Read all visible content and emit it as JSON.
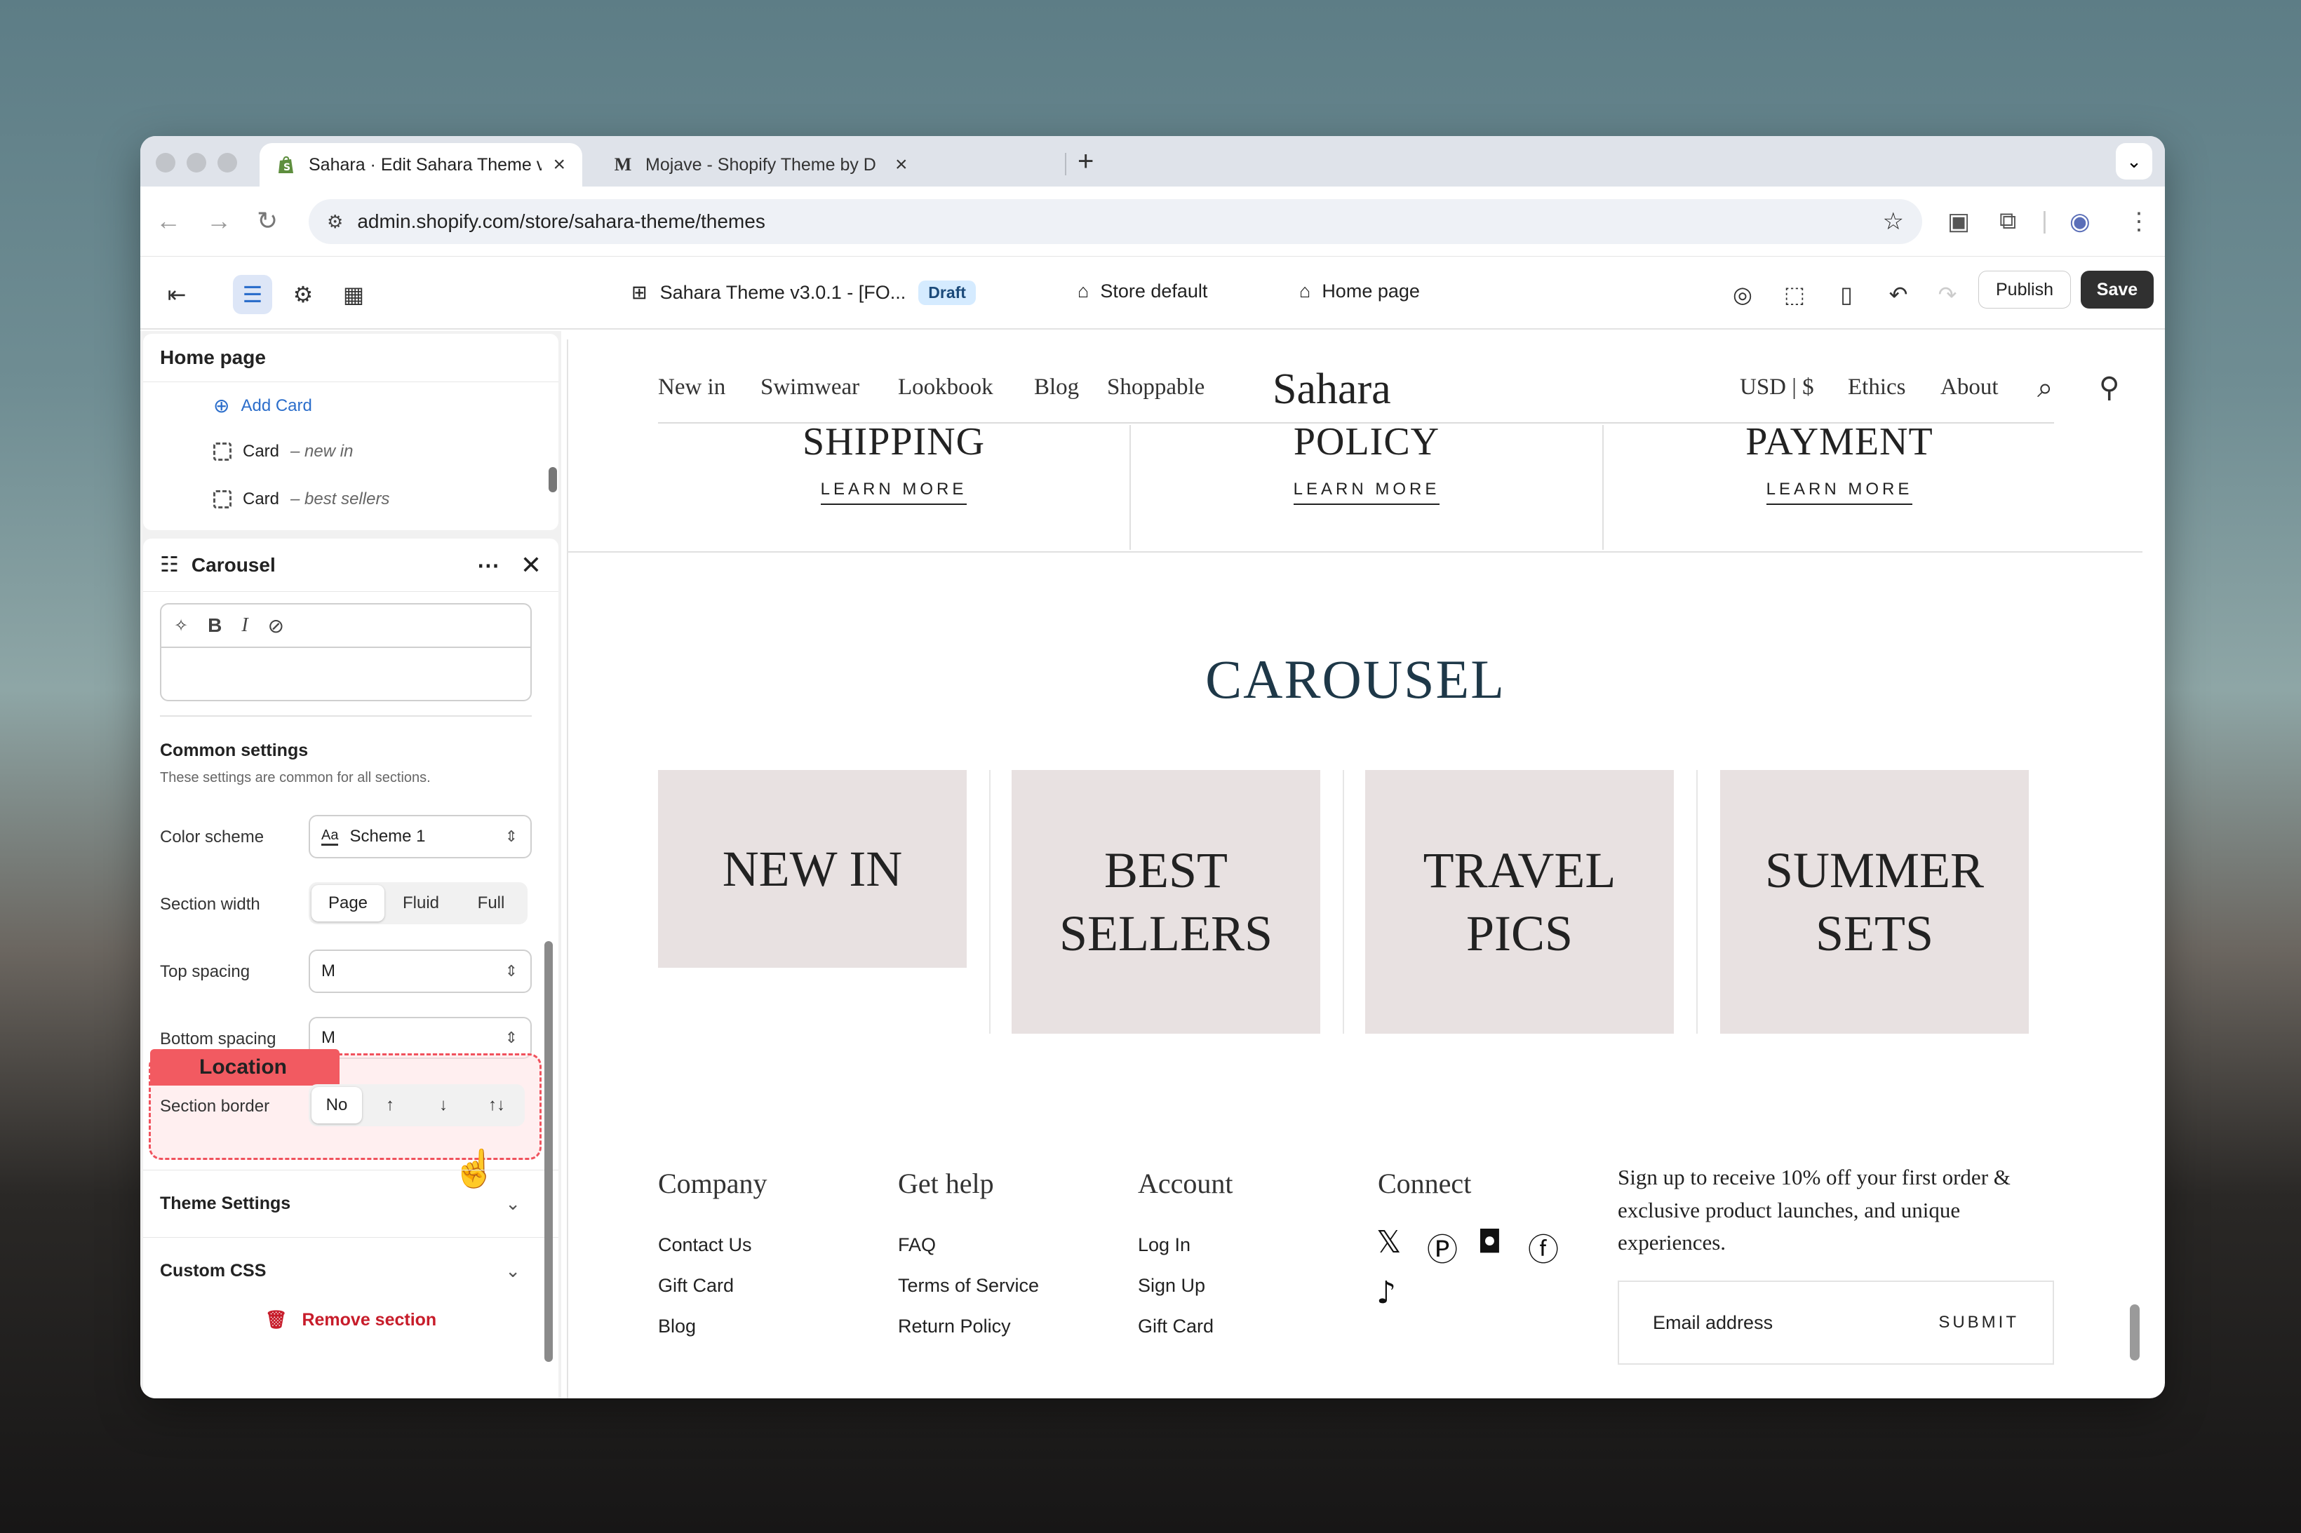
{
  "browser": {
    "tabs": [
      {
        "title": "Sahara · Edit Sahara Theme v",
        "favicon": "shopify-icon",
        "active": true
      },
      {
        "title": "Mojave - Shopify Theme by D",
        "favicon": "M",
        "active": false
      }
    ],
    "url": "admin.shopify.com/store/sahara-theme/themes"
  },
  "editor": {
    "theme_name": "Sahara Theme v3.0.1 - [FO...",
    "status_badge": "Draft",
    "context": "Store default",
    "page": "Home page",
    "publish_label": "Publish",
    "save_label": "Save"
  },
  "sidebar": {
    "tree_title": "Home page",
    "add_card": "Add Card",
    "cards": [
      {
        "label": "Card",
        "sub": "– new in"
      },
      {
        "label": "Card",
        "sub": "– best sellers"
      }
    ],
    "section_title": "Carousel",
    "common_title": "Common settings",
    "common_sub": "These settings are common for all sections.",
    "color_scheme": {
      "label": "Color scheme",
      "value": "Scheme 1",
      "swatch": "Aa"
    },
    "section_width": {
      "label": "Section width",
      "options": [
        "Page",
        "Fluid",
        "Full"
      ],
      "selected": "Page"
    },
    "top_spacing": {
      "label": "Top spacing",
      "value": "M"
    },
    "bottom_spacing": {
      "label": "Bottom spacing",
      "value": "M"
    },
    "section_border": {
      "label": "Section border",
      "options": [
        "No",
        "↑",
        "↓",
        "↑↓"
      ],
      "selected": "No"
    },
    "highlight_tag": "Location",
    "theme_settings": "Theme Settings",
    "custom_css": "Custom CSS",
    "remove": "Remove section"
  },
  "store": {
    "nav_left": [
      "New in",
      "Swimwear",
      "Lookbook",
      "Blog",
      "Shoppable"
    ],
    "logo": "Sahara",
    "currency": "USD | $",
    "nav_right": [
      "Ethics",
      "About"
    ],
    "policies": [
      {
        "title": "SHIPPING",
        "link": "LEARN MORE"
      },
      {
        "title": "POLICY",
        "link": "LEARN MORE"
      },
      {
        "title": "PAYMENT",
        "link": "LEARN MORE"
      }
    ],
    "carousel_title": "CAROUSEL",
    "tiles": [
      "NEW IN",
      "BEST SELLERS",
      "TRAVEL PICS",
      "SUMMER SETS"
    ],
    "footer": {
      "company": {
        "title": "Company",
        "links": [
          "Contact Us",
          "Gift Card",
          "Blog"
        ]
      },
      "help": {
        "title": "Get help",
        "links": [
          "FAQ",
          "Terms of Service",
          "Return Policy"
        ]
      },
      "account": {
        "title": "Account",
        "links": [
          "Log In",
          "Sign Up",
          "Gift Card"
        ]
      },
      "connect": {
        "title": "Connect",
        "icons": [
          "x-icon",
          "pinterest-icon",
          "instagram-icon",
          "facebook-icon",
          "tiktok-icon"
        ]
      },
      "signup_text": "Sign up to receive 10% off your first order & exclusive product launches, and unique experiences.",
      "email_placeholder": "Email address",
      "submit": "SUBMIT"
    }
  }
}
